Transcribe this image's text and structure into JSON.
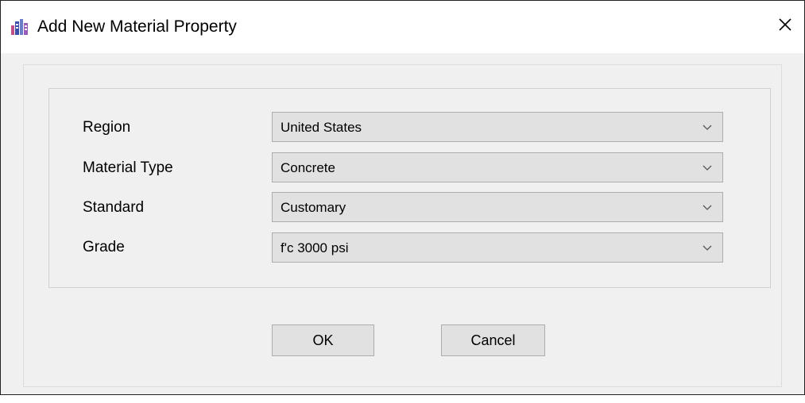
{
  "window": {
    "title": "Add New Material Property",
    "app_icon": "etabs-building-icon",
    "close_icon": "close-icon"
  },
  "form": {
    "fields": [
      {
        "label": "Region",
        "value": "United States"
      },
      {
        "label": "Material Type",
        "value": "Concrete"
      },
      {
        "label": "Standard",
        "value": "Customary"
      },
      {
        "label": "Grade",
        "value": "f'c 3000 psi"
      }
    ]
  },
  "buttons": {
    "ok_label": "OK",
    "cancel_label": "Cancel"
  },
  "colors": {
    "dialog_background": "#f0f0f0",
    "control_background": "#e1e1e1",
    "control_border": "#adadad",
    "title_bar": "#ffffff"
  }
}
